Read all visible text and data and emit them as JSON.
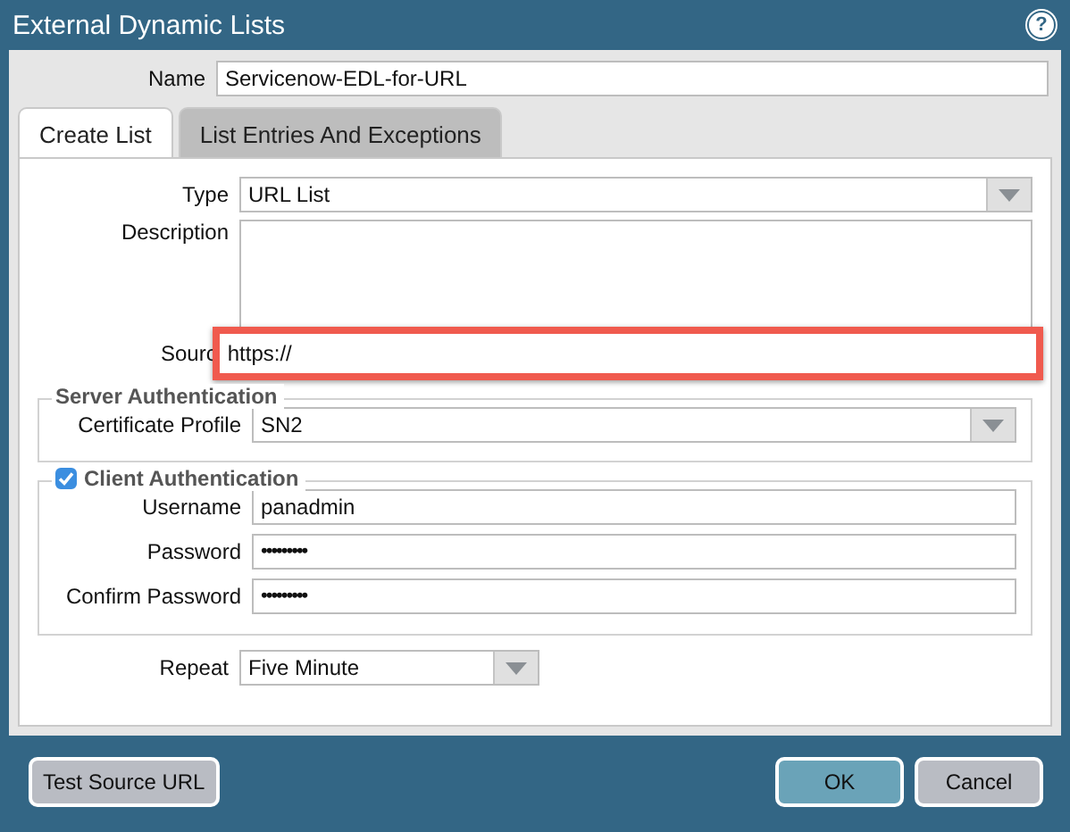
{
  "window": {
    "title": "External Dynamic Lists",
    "help": "?"
  },
  "name": {
    "label": "Name",
    "value": "Servicenow-EDL-for-URL"
  },
  "tabs": [
    {
      "label": "Create List",
      "selected": true
    },
    {
      "label": "List Entries And Exceptions",
      "selected": false
    }
  ],
  "type": {
    "label": "Type",
    "value": "URL List"
  },
  "description": {
    "label": "Description"
  },
  "source": {
    "label": "Sourc",
    "value": "https://",
    "highlighted": true
  },
  "server_authentication": {
    "title": "Server Authentication",
    "fields": [
      {
        "label": "Certificate Profile",
        "value": "SN2",
        "kind": "dropdown"
      }
    ]
  },
  "client_authentication": {
    "title": "Client Authentication",
    "checked": true,
    "fields": [
      {
        "label": "Username",
        "value": "panadmin",
        "kind": "text"
      },
      {
        "label": "Password",
        "value": "•••••••••",
        "kind": "password"
      },
      {
        "label": "Confirm Password",
        "value": "•••••••••",
        "kind": "password"
      }
    ]
  },
  "repeat": {
    "label": "Repeat",
    "value": "Five Minute"
  },
  "buttons": [
    {
      "label": "Test Source URL",
      "kind": "secondary"
    },
    {
      "label": "OK",
      "kind": "primary"
    },
    {
      "label": "Cancel",
      "kind": "secondary"
    }
  ]
}
